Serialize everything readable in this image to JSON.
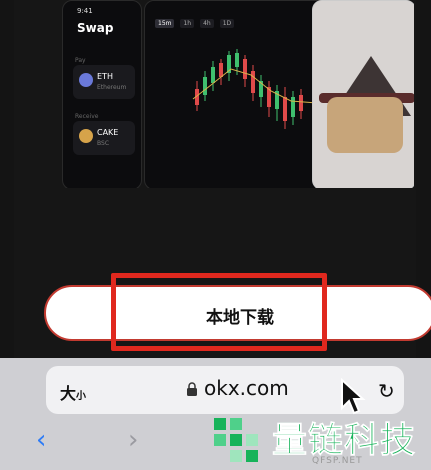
{
  "previews": {
    "swap": {
      "time": "9:41",
      "title": "Swap",
      "pay_label": "Pay",
      "receive_label": "Receive",
      "token_from": {
        "symbol": "ETH",
        "network": "Ethereum"
      },
      "token_to": {
        "symbol": "CAKE",
        "network": "BSC"
      }
    },
    "chart": {
      "tabs": [
        "15m",
        "1h",
        "4h",
        "1D"
      ],
      "plus": "+"
    }
  },
  "download_button": {
    "label": "本地下载"
  },
  "browser": {
    "text_size": {
      "big": "大",
      "small": "小"
    },
    "url": "okx.com",
    "reload": "↻",
    "back": "‹",
    "forward": "›"
  },
  "watermark": {
    "text": "量链科技",
    "sub": "QFSP.NET"
  },
  "colors": {
    "highlight": "#e0281e",
    "link_blue": "#2e7cf6",
    "watermark_green": "#17b35a"
  }
}
